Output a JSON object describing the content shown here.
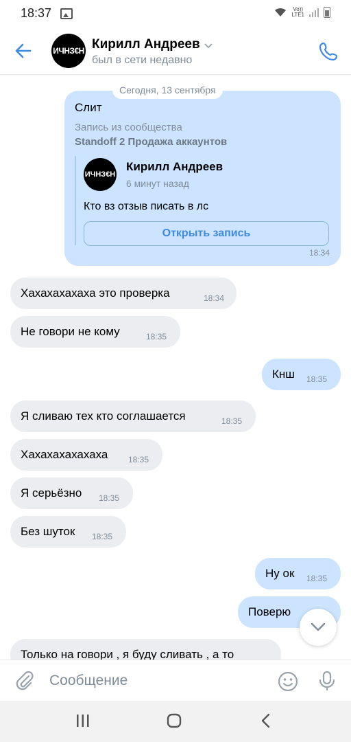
{
  "statusbar": {
    "time": "18:37",
    "volte_line1": "Vo))",
    "volte_line2": "LTE1"
  },
  "header": {
    "avatar_text": "ИЧНЗ€Н",
    "name": "Кирилл Андреев",
    "status": "был в сети недавно"
  },
  "chat": {
    "date": "Сегодня, 13 сентября",
    "repost": {
      "title": "Слит",
      "source_label": "Запись из сообщества",
      "source_name": "Standoff 2 Продажа аккаунтов",
      "author_avatar_text": "ИЧНЗ€Н",
      "author": "Кирилл Андреев",
      "ago": "6 минут назад",
      "text": "Кто вз отзыв писать в лс",
      "button": "Открыть запись",
      "time": "18:34"
    },
    "messages": [
      {
        "dir": "in",
        "text": "Хахахахахаха это проверка",
        "time": "18:34"
      },
      {
        "dir": "in",
        "text": "Не говори не кому",
        "time": "18:35"
      },
      {
        "dir": "out",
        "text": "Кнш",
        "time": "18:35"
      },
      {
        "dir": "in",
        "text": "Я сливаю тех кто соглашается",
        "time": "18:35"
      },
      {
        "dir": "in",
        "text": "Хахахахахахаха",
        "time": "18:35"
      },
      {
        "dir": "in",
        "text": "Я серьёзно",
        "time": "18:35"
      },
      {
        "dir": "in",
        "text": "Без шуток",
        "time": "18:35"
      },
      {
        "dir": "out",
        "text": "Ну ок",
        "time": "18:35"
      },
      {
        "dir": "out",
        "text": "Поверю",
        "time": ""
      },
      {
        "dir": "in",
        "text": "Только на говори , я буду сливать , а то",
        "time": ""
      }
    ]
  },
  "composer": {
    "placeholder": "Сообщение"
  },
  "colors": {
    "accent": "#3f8ae0",
    "incoming": "#ebedf0",
    "outgoing": "#cce4ff"
  }
}
